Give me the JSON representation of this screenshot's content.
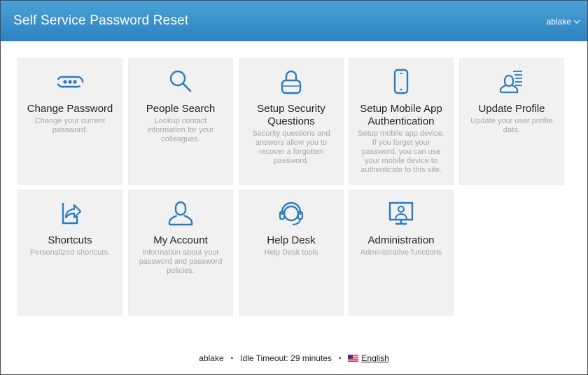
{
  "header": {
    "title": "Self Service Password Reset",
    "user": "ablake"
  },
  "tiles": [
    {
      "title": "Change Password",
      "desc": "Change your current password.",
      "icon": "password-dots-icon"
    },
    {
      "title": "People Search",
      "desc": "Lookup contact information for your colleagues.",
      "icon": "search-icon"
    },
    {
      "title": "Setup Security Questions",
      "desc": "Security questions and answers allow you to recover a forgotten password.",
      "icon": "lock-icon"
    },
    {
      "title": "Setup Mobile App Authentication",
      "desc": "Setup mobile app device. If you forget your password, you can use your mobile device to authenticate to this site.",
      "icon": "mobile-phone-icon"
    },
    {
      "title": "Update Profile",
      "desc": "Update your user profile data.",
      "icon": "user-profile-icon"
    },
    {
      "title": "Shortcuts",
      "desc": "Personalized shortcuts.",
      "icon": "shortcut-arrow-icon"
    },
    {
      "title": "My Account",
      "desc": "Information about your password and password policies.",
      "icon": "user-icon"
    },
    {
      "title": "Help Desk",
      "desc": "Help Desk tools",
      "icon": "headset-icon"
    },
    {
      "title": "Administration",
      "desc": "Administrative functions",
      "icon": "monitor-user-icon"
    }
  ],
  "footer": {
    "user": "ablake",
    "idle_timeout": "Idle Timeout: 29 minutes",
    "language": "English",
    "separator": "•"
  },
  "colors": {
    "header_top": "#4ba2d6",
    "header_bottom": "#2c82c0",
    "icon": "#2b7bbf",
    "tile_bg": "#f1f1f1"
  }
}
